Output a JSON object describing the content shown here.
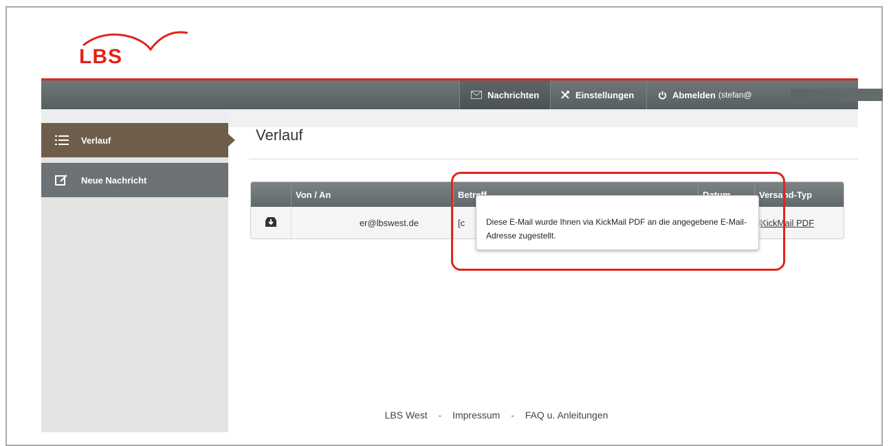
{
  "brand": {
    "logo_text": "LBS",
    "color": "#e2231a"
  },
  "topnav": {
    "items": [
      {
        "label": "Nachrichten",
        "icon": "envelope-icon"
      },
      {
        "label": "Einstellungen",
        "icon": "tools-icon"
      },
      {
        "label": "Abmelden",
        "icon": "power-icon",
        "user": "(stefan@"
      }
    ]
  },
  "sidebar": {
    "items": [
      {
        "label": "Verlauf",
        "icon": "list-icon",
        "active": true
      },
      {
        "label": "Neue Nachricht",
        "icon": "compose-icon"
      }
    ]
  },
  "page": {
    "title": "Verlauf"
  },
  "table": {
    "headers": {
      "icon": "",
      "from_to": "Von / An",
      "subject": "Betreff",
      "date": "Datum",
      "type": "Versand-Typ"
    },
    "rows": [
      {
        "icon": "inbox-download-icon",
        "from_to": "er@lbswest.de",
        "subject": "[c",
        "type_link": "KickMail PDF"
      }
    ]
  },
  "tooltip": {
    "text": "Diese E-Mail wurde Ihnen via KickMail PDF an die angegebene E-Mail-Adresse zugestellt."
  },
  "footer": {
    "links": [
      "LBS West",
      "Impressum",
      "FAQ u. Anleitungen"
    ],
    "separator": "-"
  },
  "colors": {
    "topbar": "#5f6769",
    "sidebar_active": "#6f5d4b",
    "sidebar_item": "#6c7275",
    "highlight": "#e2231a"
  }
}
